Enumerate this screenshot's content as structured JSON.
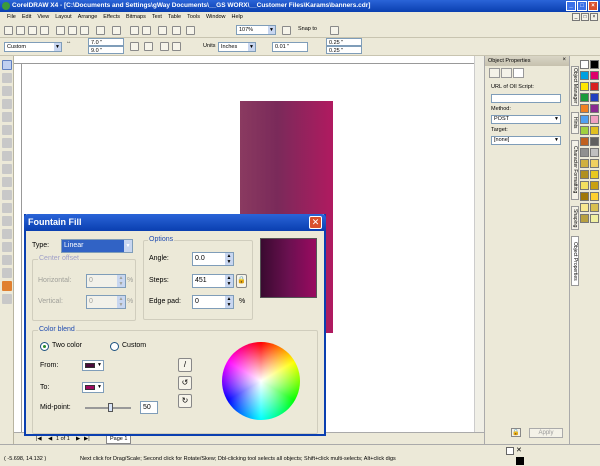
{
  "window": {
    "title": "CorelDRAW X4 - [C:\\Documents and Settings\\gWay Documents\\__GS WORX\\__Customer Files\\Karams\\banners.cdr]"
  },
  "menu": [
    "File",
    "Edit",
    "View",
    "Layout",
    "Arrange",
    "Effects",
    "Bitmaps",
    "Text",
    "Table",
    "Tools",
    "Window",
    "Help"
  ],
  "toolbar": {
    "zoom": "107%",
    "snap": "Snap to",
    "paper": "Custom",
    "width": "7.0 \"",
    "height": "9.0 \"",
    "units": "Inches",
    "nudge": "0.01 \"",
    "dup_x": "0.25 \"",
    "dup_y": "0.25 \""
  },
  "docker": {
    "title": "Object Properties",
    "url_label": "URL of OII Script:",
    "method_label": "Method:",
    "method_value": "POST",
    "target_label": "Target:",
    "target_value": "[none]",
    "apply_label": "Apply"
  },
  "right_tabs": [
    "Object Manager",
    "Hints",
    "Character Formatting",
    "Shaping",
    "Object Properties"
  ],
  "dialog": {
    "title": "Fountain Fill",
    "type_label": "Type:",
    "type_value": "Linear",
    "options_title": "Options",
    "angle_label": "Angle:",
    "angle_value": "0.0",
    "steps_label": "Steps:",
    "steps_value": "451",
    "edgepad_label": "Edge pad:",
    "edgepad_value": "0",
    "edgepad_unit": "%",
    "center_title": "Center offset",
    "horizontal_label": "Horizontal:",
    "horizontal_value": "0",
    "horizontal_unit": "%",
    "vertical_label": "Vertical:",
    "vertical_value": "0",
    "vertical_unit": "%",
    "colorblend_title": "Color blend",
    "two_color_label": "Two color",
    "custom_label": "Custom",
    "from_label": "From:",
    "to_label": "To:",
    "midpoint_label": "Mid-point:",
    "midpoint_value": "50",
    "from_color": "#4a0a3a",
    "to_color": "#a00a60"
  },
  "pagebar": {
    "counter": "1 of 1",
    "page_tab": "Page 1"
  },
  "status": {
    "coords": "( -5.698, 14.132 )",
    "hint": "Next click for Drag/Scale; Second click for Rotate/Skew; Dbl-clicking tool selects all objects; Shift+click multi-selects; Alt+click digs"
  },
  "palette_colors": [
    "#ffffff",
    "#000000",
    "#00a0e0",
    "#e0006a",
    "#ffe600",
    "#d82020",
    "#1a9a3a",
    "#2040c0",
    "#f08020",
    "#8a2a90",
    "#50a0f0",
    "#f0a0c0",
    "#a0d040",
    "#e0c020",
    "#c06020",
    "#606060",
    "#909090",
    "#c0c0c0",
    "#d0b040",
    "#f0d060",
    "#b09020",
    "#e8c820",
    "#f4e060",
    "#c8a010",
    "#a07808",
    "#ffd030",
    "#f8e890",
    "#d8c050",
    "#b8a040",
    "#f0f0a0"
  ]
}
